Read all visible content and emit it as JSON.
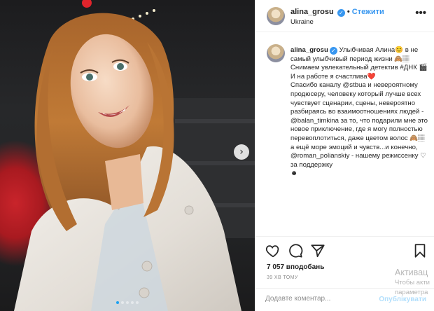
{
  "header": {
    "username": "alina_grosu",
    "verified_mark": "✓",
    "separator": "•",
    "follow_label": "Стежити",
    "location": "Ukraine",
    "more_label": "•••"
  },
  "photo": {
    "next_label": "›",
    "carousel": {
      "count": 5,
      "active": 1
    }
  },
  "caption": {
    "username": "alina_grosu",
    "text": " Улыбчивая Алина😊 в не самый улыбчивый период жизни 🙈🏽\nСнимаем увлекательный детектив #ДНК 🎬\nИ на работе я счастлива❤️\nСпасибо каналу @stbua и невероятному продюсеру, человеку который лучше всех чувствует сценарии, сцены, невероятно разбираясь во взаимоотношениях людей - @balan_timkina за то, что подарили мне это новое приключение, где я могу полностью перевоплотиться, даже цветом волос 🙈🏽 а ещё море эмоций и чувств...и конечно, @roman_polianskiy - нашему режиссенку ♡ за поддержку\n☻"
  },
  "actions": {
    "like_icon": "heart-icon",
    "comment_icon": "comment-icon",
    "share_icon": "share-icon",
    "save_icon": "bookmark-icon"
  },
  "likes_text": "7 057 вподобань",
  "time_text": "39 ХВ ТОМУ",
  "comment": {
    "placeholder": "Додавте коментар...",
    "publish_label": "Опублікувати"
  },
  "watermark": {
    "line1": "Активац",
    "line2": "Чтобы акти",
    "line3": "параметра"
  },
  "colors": {
    "accent": "#3897f0",
    "publish_disabled": "#b2dffc",
    "border": "#efefef",
    "muted": "#8e8e8e"
  }
}
